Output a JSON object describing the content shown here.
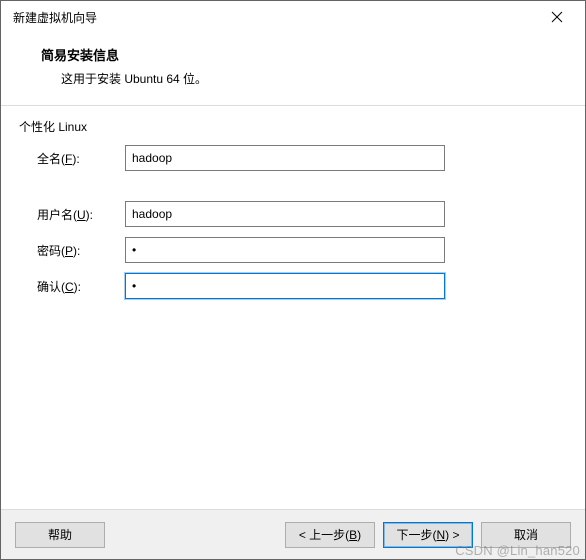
{
  "titlebar": {
    "title": "新建虚拟机向导"
  },
  "header": {
    "title": "简易安装信息",
    "subtitle": "这用于安装 Ubuntu 64 位。"
  },
  "section": {
    "label": "个性化 Linux"
  },
  "form": {
    "fullname": {
      "label_prefix": "全名(",
      "label_hotkey": "F",
      "label_suffix": "):",
      "value": "hadoop"
    },
    "username": {
      "label_prefix": "用户名(",
      "label_hotkey": "U",
      "label_suffix": "):",
      "value": "hadoop"
    },
    "password": {
      "label_prefix": "密码(",
      "label_hotkey": "P",
      "label_suffix": "):",
      "value": "1"
    },
    "confirm": {
      "label_prefix": "确认(",
      "label_hotkey": "C",
      "label_suffix": "):",
      "value": "1"
    }
  },
  "buttons": {
    "help": "帮助",
    "back_prefix": "< 上一步(",
    "back_hotkey": "B",
    "back_suffix": ")",
    "next_prefix": "下一步(",
    "next_hotkey": "N",
    "next_suffix": ") >",
    "cancel": "取消"
  },
  "watermark": "CSDN @Lin_han520"
}
